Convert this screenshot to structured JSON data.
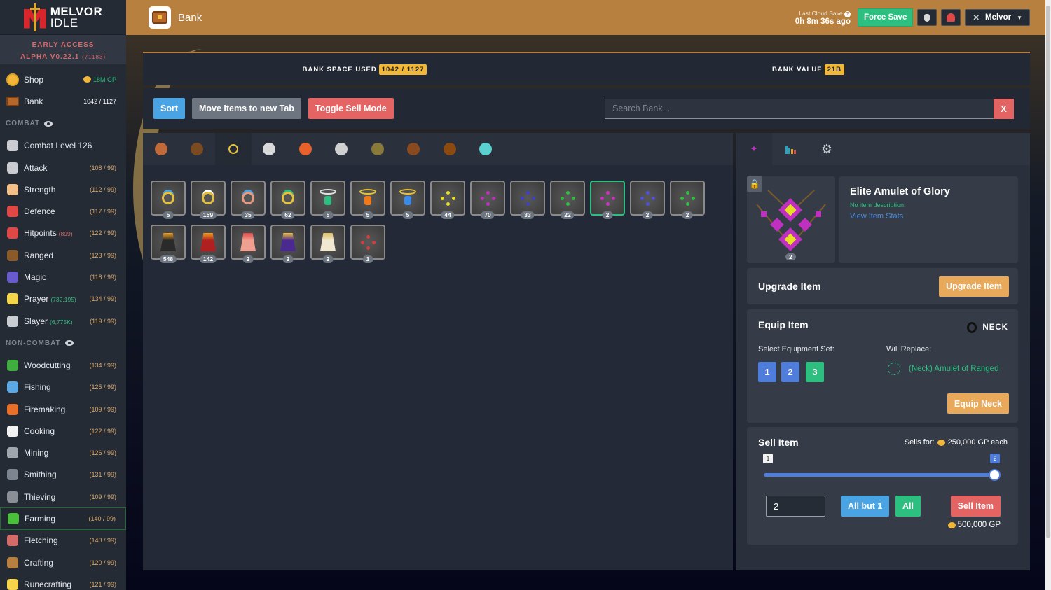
{
  "app": {
    "logo_line1": "MELVOR",
    "logo_line2": "IDLE",
    "version_line1": "EARLY ACCESS",
    "version_line2": "ALPHA V0.22.1",
    "version_build": "(71183)"
  },
  "sidebar": {
    "shop": {
      "label": "Shop",
      "value": "18M GP",
      "icon": "coin-icon"
    },
    "bank": {
      "label": "Bank",
      "value": "1042 / 1127",
      "icon": "chest-icon"
    },
    "combat_header": "COMBAT",
    "combat": [
      {
        "label": "Combat Level 126",
        "extra": "",
        "level": "",
        "icon": "crossed-swords-icon",
        "color": "#c9ccd1"
      },
      {
        "label": "Attack",
        "extra": "",
        "level": "(108 / 99)",
        "icon": "sword-icon",
        "color": "#c9ccd1"
      },
      {
        "label": "Strength",
        "extra": "",
        "level": "(112 / 99)",
        "icon": "arm-icon",
        "color": "#f3c08a"
      },
      {
        "label": "Defence",
        "extra": "",
        "level": "(117 / 99)",
        "icon": "shield-icon",
        "color": "#e04848"
      },
      {
        "label": "Hitpoints",
        "extra": "(899)",
        "extra_color": "#d46b6b",
        "level": "(122 / 99)",
        "icon": "heart-icon",
        "color": "#e04848"
      },
      {
        "label": "Ranged",
        "extra": "",
        "level": "(123 / 99)",
        "icon": "bow-icon",
        "color": "#8a5a2a"
      },
      {
        "label": "Magic",
        "extra": "",
        "level": "(118 / 99)",
        "icon": "wizard-hat-icon",
        "color": "#6a5ad0"
      },
      {
        "label": "Prayer",
        "extra": "(732,195)",
        "extra_color": "#2cbf7f",
        "level": "(134 / 99)",
        "icon": "sparkle-icon",
        "color": "#f3d44a"
      },
      {
        "label": "Slayer",
        "extra": "(6,775K)",
        "extra_color": "#2cbf7f",
        "level": "(119 / 99)",
        "icon": "sword-in-stone-icon",
        "color": "#c9ccd1"
      }
    ],
    "noncombat_header": "NON-COMBAT",
    "noncombat": [
      {
        "label": "Woodcutting",
        "level": "(134 / 99)",
        "icon": "tree-icon",
        "color": "#3fae3f",
        "active": false
      },
      {
        "label": "Fishing",
        "level": "(125 / 99)",
        "icon": "fish-icon",
        "color": "#5aa9e6",
        "active": false
      },
      {
        "label": "Firemaking",
        "level": "(109 / 99)",
        "icon": "campfire-icon",
        "color": "#e8702a",
        "active": false
      },
      {
        "label": "Cooking",
        "level": "(122 / 99)",
        "icon": "chef-hat-icon",
        "color": "#f2f2f2",
        "active": false
      },
      {
        "label": "Mining",
        "level": "(126 / 99)",
        "icon": "pickaxe-icon",
        "color": "#a0a6ad",
        "active": false
      },
      {
        "label": "Smithing",
        "level": "(131 / 99)",
        "icon": "anvil-icon",
        "color": "#7d8591",
        "active": false
      },
      {
        "label": "Thieving",
        "level": "(109 / 99)",
        "icon": "thief-icon",
        "color": "#8a8f96",
        "active": false
      },
      {
        "label": "Farming",
        "level": "(140 / 99)",
        "icon": "sprout-icon",
        "color": "#4cbf3a",
        "active": true
      },
      {
        "label": "Fletching",
        "level": "(140 / 99)",
        "icon": "arrow-icon",
        "color": "#d46b6b",
        "active": false
      },
      {
        "label": "Crafting",
        "level": "(120 / 99)",
        "icon": "tools-icon",
        "color": "#b8803e",
        "active": false
      },
      {
        "label": "Runecrafting",
        "level": "(121 / 99)",
        "icon": "rune-icon",
        "color": "#f3d44a",
        "active": false
      }
    ]
  },
  "header": {
    "title": "Bank",
    "cloud_label": "Last Cloud Save",
    "cloud_time": "0h 8m 36s ago",
    "force_save": "Force Save",
    "user": "Melvor"
  },
  "stats": {
    "space_label": "BANK SPACE USED",
    "space_value": "1042 / 1127",
    "value_label": "BANK VALUE",
    "value_value": "21B"
  },
  "toolbar": {
    "sort": "Sort",
    "move": "Move Items to new Tab",
    "toggle_sell": "Toggle Sell Mode",
    "search_placeholder": "Search Bank...",
    "clear": "X"
  },
  "bank_tabs": [
    {
      "name": "tab-food",
      "icon": "food-icon",
      "color": "#c06a3a",
      "active": false
    },
    {
      "name": "tab-logs",
      "icon": "log-icon",
      "color": "#7a4a20",
      "active": false
    },
    {
      "name": "tab-jewellery",
      "icon": "ring-icon",
      "color": "#e5c13b",
      "active": true
    },
    {
      "name": "tab-potions",
      "icon": "potion-icon",
      "color": "#d8d8d8",
      "active": false
    },
    {
      "name": "tab-fish",
      "icon": "shrimp-icon",
      "color": "#e8602a",
      "active": false
    },
    {
      "name": "tab-ores",
      "icon": "silver-ore-icon",
      "color": "#d0d0d0",
      "active": false
    },
    {
      "name": "tab-seeds",
      "icon": "seeds-icon",
      "color": "#8a7a3a",
      "active": false
    },
    {
      "name": "tab-weapons",
      "icon": "dagger-icon",
      "color": "#8a4a20",
      "active": false
    },
    {
      "name": "tab-leather",
      "icon": "leather-icon",
      "color": "#8a4a10",
      "active": false
    },
    {
      "name": "tab-arrows",
      "icon": "bolt-icon",
      "color": "#5ad0d0",
      "active": false
    }
  ],
  "items": [
    {
      "name": "ring-sapphire",
      "qty": "5",
      "type": "ring",
      "color": "#e5c13b",
      "gem": "#4aa3e3"
    },
    {
      "name": "ring-diamond",
      "qty": "159",
      "type": "ring",
      "color": "#e5c13b",
      "gem": "#ffffff"
    },
    {
      "name": "ring-rose",
      "qty": "35",
      "type": "ring",
      "color": "#e89a80",
      "gem": "#4aa3e3"
    },
    {
      "name": "ring-emerald",
      "qty": "62",
      "type": "ring",
      "color": "#e5c13b",
      "gem": "#2cbf7f"
    },
    {
      "name": "necklace-emerald",
      "qty": "5",
      "type": "necklace",
      "color": "#e0e0e0",
      "gem": "#2cbf7f"
    },
    {
      "name": "necklace-topaz",
      "qty": "5",
      "type": "necklace",
      "color": "#e5c13b",
      "gem": "#f07a1a"
    },
    {
      "name": "necklace-sapphire",
      "qty": "5",
      "type": "necklace",
      "color": "#e5c13b",
      "gem": "#3a8ae8"
    },
    {
      "name": "amulet-of-glory-yellow",
      "qty": "44",
      "type": "amulet",
      "color": "#e8e020"
    },
    {
      "name": "amulet-of-glory-magenta",
      "qty": "70",
      "type": "amulet",
      "color": "#c030c0"
    },
    {
      "name": "amulet-of-glory-blue",
      "qty": "33",
      "type": "amulet",
      "color": "#3a40d0"
    },
    {
      "name": "amulet-of-glory-green",
      "qty": "22",
      "type": "amulet",
      "color": "#30c040"
    },
    {
      "name": "elite-amulet-of-glory",
      "qty": "2",
      "type": "amulet",
      "color": "#d030c0",
      "selected": true
    },
    {
      "name": "elite-amulet-blue",
      "qty": "2",
      "type": "amulet",
      "color": "#5050e0"
    },
    {
      "name": "elite-amulet-green",
      "qty": "2",
      "type": "amulet",
      "color": "#30c040"
    },
    {
      "name": "cape-black-gold",
      "qty": "548",
      "type": "cape",
      "color": "#2a2a2a",
      "trim": "#f0a020"
    },
    {
      "name": "cape-red-gold",
      "qty": "142",
      "type": "cape",
      "color": "#b02020",
      "trim": "#f0a020"
    },
    {
      "name": "cape-pink",
      "qty": "2",
      "type": "cape",
      "color": "#f0a090",
      "trim": "#e04848"
    },
    {
      "name": "cape-purple",
      "qty": "2",
      "type": "cape",
      "color": "#4a2a90",
      "trim": "#f0c040"
    },
    {
      "name": "cape-white",
      "qty": "2",
      "type": "cape",
      "color": "#f0e8d0",
      "trim": "#e0c060"
    },
    {
      "name": "rainbow-amulet",
      "qty": "1",
      "type": "amulet",
      "color": "#d04040"
    }
  ],
  "side_tabs": [
    {
      "name": "side-tab-item",
      "icon": "amulet-icon",
      "active": true
    },
    {
      "name": "side-tab-stats",
      "icon": "bar-chart-icon",
      "active": false
    },
    {
      "name": "side-tab-settings",
      "icon": "gear-icon",
      "active": false
    }
  ],
  "selected_item": {
    "name": "Elite Amulet of Glory",
    "qty": "2",
    "description": "No item description.",
    "stats_link": "View Item Stats"
  },
  "upgrade": {
    "title": "Upgrade Item",
    "button": "Upgrade Item"
  },
  "equip": {
    "title": "Equip Item",
    "slot": "NECK",
    "set_label": "Select Equipment Set:",
    "sets": [
      "1",
      "2",
      "3"
    ],
    "selected_set": "3",
    "replace_label": "Will Replace:",
    "replace_item": "(Neck) Amulet of Ranged",
    "button": "Equip Neck"
  },
  "sell": {
    "title": "Sell Item",
    "sells_for_label": "Sells for:",
    "sells_for_value": "250,000 GP each",
    "slider_min": "1",
    "slider_max": "2",
    "slider_value": 2,
    "quantity": "2",
    "all_but_one": "All but 1",
    "all": "All",
    "sell_button": "Sell Item",
    "total": "500,000 GP"
  },
  "colors": {
    "header": "#b8803e",
    "green": "#2cbf7f",
    "red": "#e46363",
    "blue": "#4aa3e3",
    "orange": "#e9a95a",
    "gold": "#f3b737"
  }
}
